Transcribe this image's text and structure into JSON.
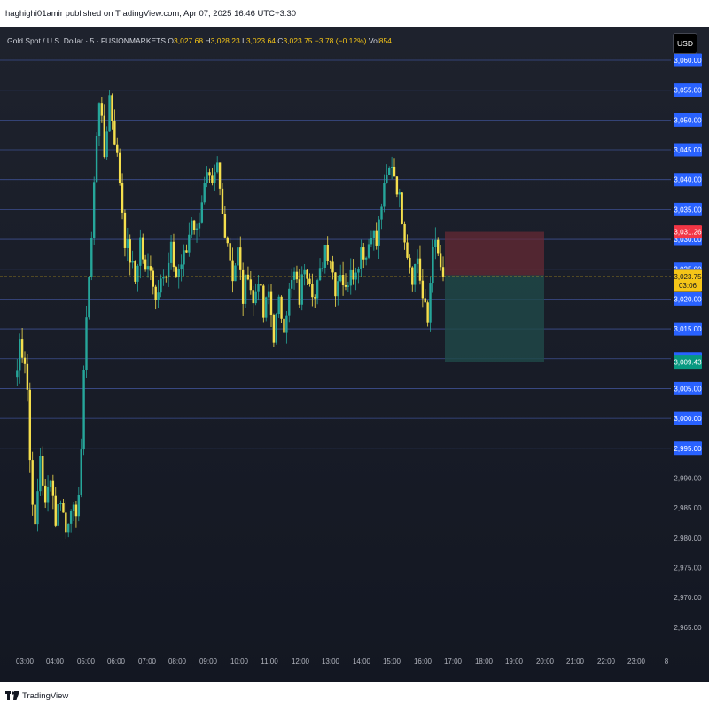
{
  "header": {
    "published": "haghighi01amir published on TradingView.com, Apr 07, 2025 16:46 UTC+3:30"
  },
  "legend": {
    "symbol": "Gold Spot / U.S. Dollar · 5 · FUSIONMARKETS",
    "o_label": "O",
    "o_value": "3,027.68",
    "h_label": "H",
    "h_value": "3,028.23",
    "l_label": "L",
    "l_value": "3,023.64",
    "c_label": "C",
    "c_value": "3,023.75",
    "change": "−3.78 (−0.12%)",
    "vol_label": "Vol",
    "vol_value": "854"
  },
  "currency_button": "USD",
  "footer": {
    "brand": "TradingView"
  },
  "colors": {
    "up": "#26a69a",
    "down": "#f5df4d",
    "level_line": "#3d4f8f",
    "badge_blue": "#2962ff",
    "stop_zone": "#6b2a35",
    "target_zone": "#1f4a48",
    "current_price": "#f5c518"
  },
  "chart_data": {
    "type": "candlestick",
    "symbol": "XAUUSD",
    "timeframe": "5",
    "ylim": [
      2962,
      3062
    ],
    "x_ticks": [
      "03:00",
      "04:00",
      "05:00",
      "06:00",
      "07:00",
      "08:00",
      "09:00",
      "10:00",
      "11:00",
      "12:00",
      "13:00",
      "14:00",
      "15:00",
      "16:00",
      "17:00",
      "18:00",
      "19:00",
      "20:00",
      "21:00",
      "22:00",
      "23:00",
      "8"
    ],
    "y_ticks": [
      {
        "value": 2965,
        "label": "2,965.00"
      },
      {
        "value": 2970,
        "label": "2,970.00"
      },
      {
        "value": 2975,
        "label": "2,975.00"
      },
      {
        "value": 2980,
        "label": "2,980.00"
      },
      {
        "value": 2985,
        "label": "2,985.00"
      },
      {
        "value": 2990,
        "label": "2,990.00"
      }
    ],
    "levels": [
      {
        "value": 3060,
        "label": "3,060.00"
      },
      {
        "value": 3055,
        "label": "3,055.00"
      },
      {
        "value": 3050,
        "label": "3,050.00"
      },
      {
        "value": 3045,
        "label": "3,045.00"
      },
      {
        "value": 3040,
        "label": "3,040.00"
      },
      {
        "value": 3035,
        "label": "3,035.00"
      },
      {
        "value": 3030,
        "label": "3,030.00"
      },
      {
        "value": 3025,
        "label": "3,025.00"
      },
      {
        "value": 3020,
        "label": "3,020.00"
      },
      {
        "value": 3015,
        "label": "3,015.00"
      },
      {
        "value": 3010,
        "label": "3,010.00"
      },
      {
        "value": 3005,
        "label": "3,005.00"
      },
      {
        "value": 3000,
        "label": "3,000.00"
      },
      {
        "value": 2995,
        "label": "2,995.00"
      }
    ],
    "position": {
      "stop": {
        "value": 3031.26,
        "label": "3,031.26"
      },
      "entry": {
        "value": 3023.99,
        "label": "3,023.99"
      },
      "target": {
        "value": 3009.43,
        "label": "3,009.43"
      }
    },
    "current_price": {
      "value": 3023.75,
      "label": "3,023.75",
      "countdown": "03:06"
    },
    "close_path": [
      [
        "02:45",
        3008
      ],
      [
        "02:50",
        3013
      ],
      [
        "03:00",
        3010
      ],
      [
        "03:05",
        3005
      ],
      [
        "03:10",
        2993
      ],
      [
        "03:20",
        2981
      ],
      [
        "03:30",
        2994
      ],
      [
        "03:40",
        2985
      ],
      [
        "03:50",
        2991
      ],
      [
        "04:00",
        2983
      ],
      [
        "04:10",
        2987
      ],
      [
        "04:20",
        2981
      ],
      [
        "04:30",
        2986
      ],
      [
        "04:40",
        2982
      ],
      [
        "04:50",
        2995
      ],
      [
        "05:00",
        3018
      ],
      [
        "05:10",
        3030
      ],
      [
        "05:20",
        3048
      ],
      [
        "05:25",
        3054
      ],
      [
        "05:35",
        3044
      ],
      [
        "05:45",
        3054
      ],
      [
        "05:55",
        3047
      ],
      [
        "06:05",
        3040
      ],
      [
        "06:15",
        3030
      ],
      [
        "06:25",
        3027
      ],
      [
        "06:35",
        3023
      ],
      [
        "06:45",
        3030
      ],
      [
        "06:55",
        3024
      ],
      [
        "07:05",
        3026
      ],
      [
        "07:15",
        3020
      ],
      [
        "07:25",
        3025
      ],
      [
        "07:35",
        3023
      ],
      [
        "07:45",
        3028
      ],
      [
        "07:55",
        3024
      ],
      [
        "08:05",
        3026
      ],
      [
        "08:15",
        3028
      ],
      [
        "08:25",
        3034
      ],
      [
        "08:35",
        3031
      ],
      [
        "08:45",
        3037
      ],
      [
        "08:55",
        3040
      ],
      [
        "09:05",
        3038
      ],
      [
        "09:15",
        3042
      ],
      [
        "09:25",
        3034
      ],
      [
        "09:35",
        3030
      ],
      [
        "09:45",
        3024
      ],
      [
        "09:55",
        3028
      ],
      [
        "10:05",
        3020
      ],
      [
        "10:15",
        3025
      ],
      [
        "10:25",
        3019
      ],
      [
        "10:35",
        3024
      ],
      [
        "10:45",
        3017
      ],
      [
        "10:55",
        3021
      ],
      [
        "11:05",
        3014
      ],
      [
        "11:15",
        3019
      ],
      [
        "11:25",
        3016
      ],
      [
        "11:35",
        3021
      ],
      [
        "11:45",
        3024
      ],
      [
        "11:55",
        3020
      ],
      [
        "12:05",
        3026
      ],
      [
        "12:15",
        3024
      ],
      [
        "12:25",
        3020
      ],
      [
        "12:35",
        3024
      ],
      [
        "12:45",
        3029
      ],
      [
        "12:55",
        3027
      ],
      [
        "13:05",
        3022
      ],
      [
        "13:15",
        3025
      ],
      [
        "13:25",
        3021
      ],
      [
        "13:35",
        3026
      ],
      [
        "13:45",
        3024
      ],
      [
        "13:55",
        3029
      ],
      [
        "14:05",
        3027
      ],
      [
        "14:15",
        3032
      ],
      [
        "14:25",
        3029
      ],
      [
        "14:35",
        3036
      ],
      [
        "14:45",
        3040
      ],
      [
        "14:55",
        3043
      ],
      [
        "15:05",
        3039
      ],
      [
        "15:15",
        3034
      ],
      [
        "15:25",
        3028
      ],
      [
        "15:35",
        3024
      ],
      [
        "15:45",
        3027
      ],
      [
        "15:55",
        3020
      ],
      [
        "16:05",
        3016
      ],
      [
        "16:15",
        3030
      ],
      [
        "16:25",
        3027
      ],
      [
        "16:35",
        3023.75
      ]
    ]
  }
}
